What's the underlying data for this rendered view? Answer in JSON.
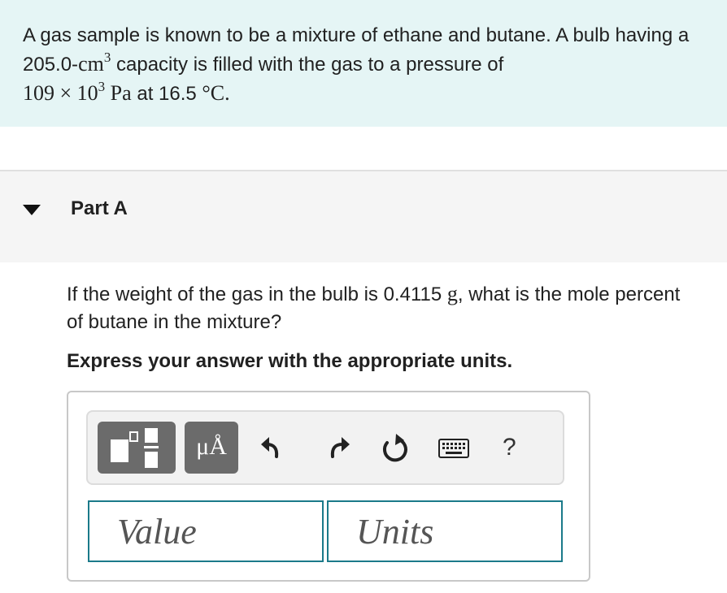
{
  "intro": {
    "text_1": "A gas sample is known to be a mixture of ethane and butane. A bulb having a 205.0-",
    "volume_unit": "cm",
    "volume_exp": "3",
    "text_2": " capacity is filled with the gas to a pressure of",
    "pressure_value": "109 × 10",
    "pressure_exp": "3",
    "pressure_unit": " Pa",
    "text_3": " at 16.5 ",
    "temperature_unit": "°C",
    "text_4": "."
  },
  "part": {
    "title": "Part A"
  },
  "question": {
    "text_1": "If the weight of the gas in the bulb is 0.4115 ",
    "mass_unit": "g",
    "text_2": ", what is the mole percent of butane in the mixture?"
  },
  "instruction": "Express your answer with the appropriate units.",
  "toolbar": {
    "units_label": "μÅ",
    "help_label": "?"
  },
  "inputs": {
    "value_placeholder": "Value",
    "units_placeholder": "Units"
  },
  "colors": {
    "intro_bg": "#e5f5f5",
    "header_bg": "#f5f5f5",
    "input_border": "#1b7a8a",
    "tool_button": "#6b6b6b"
  }
}
